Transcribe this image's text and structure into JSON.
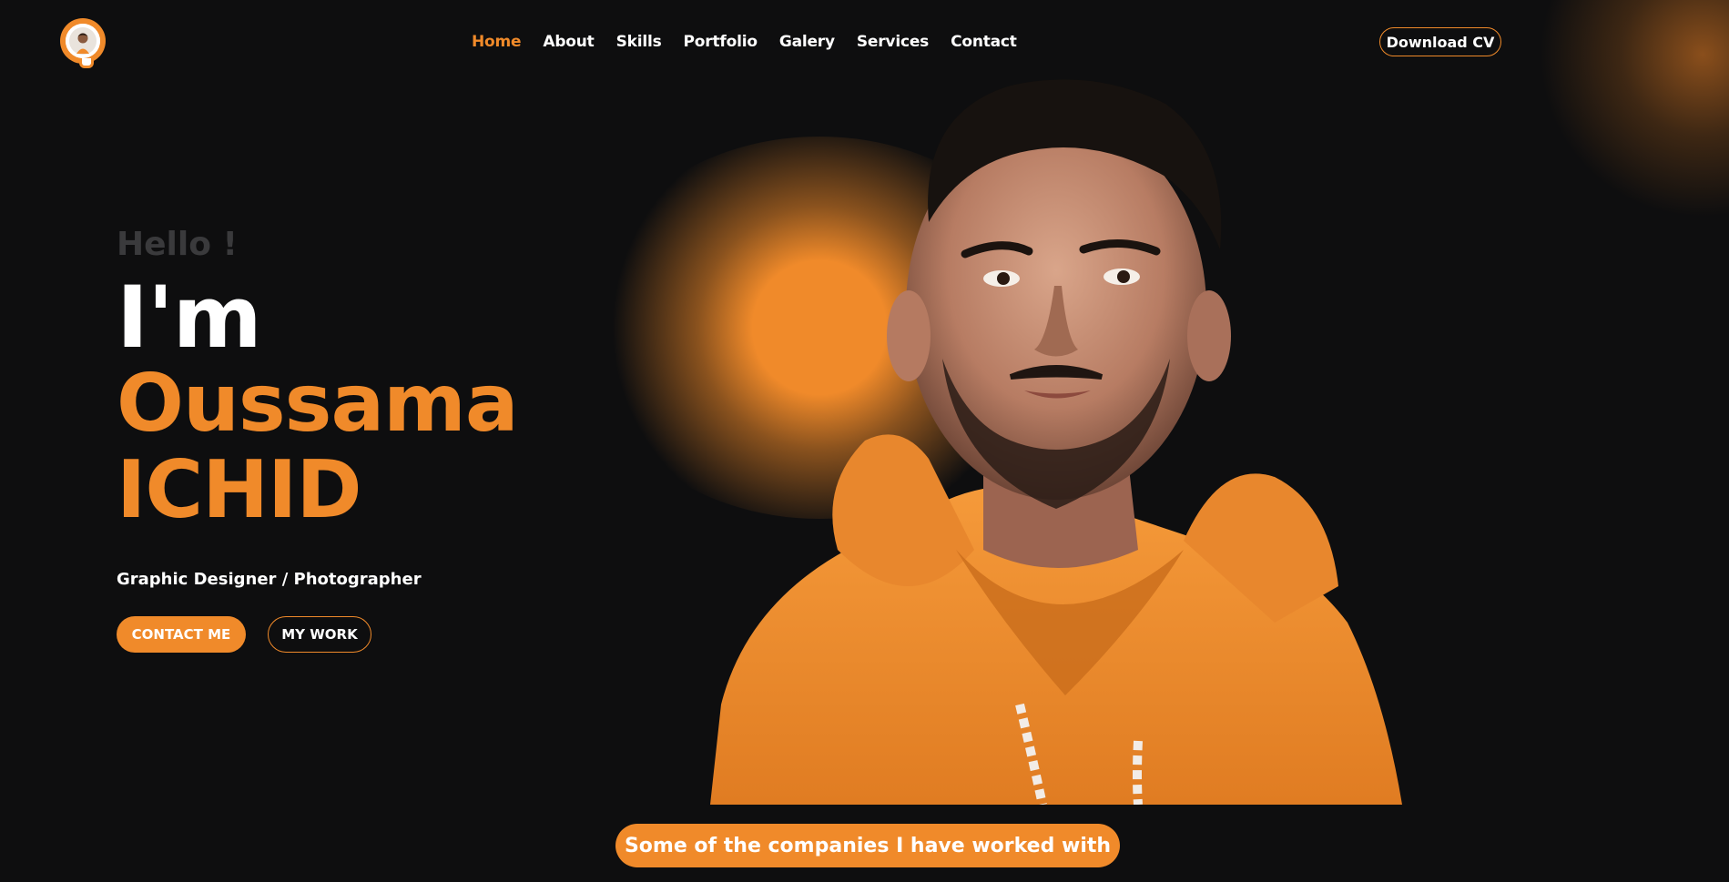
{
  "header": {
    "logo_icon": "avatar-logo-icon",
    "nav": [
      {
        "label": "Home",
        "active": true
      },
      {
        "label": "About"
      },
      {
        "label": "Skills"
      },
      {
        "label": "Portfolio"
      },
      {
        "label": "Galery"
      },
      {
        "label": "Services"
      },
      {
        "label": "Contact"
      }
    ],
    "cv_button": "Download CV"
  },
  "hero": {
    "greeting": "Hello !",
    "intro": "I'm",
    "first_name": "Oussama",
    "last_name": "ICHID",
    "role": "Graphic Designer / Photographer",
    "contact_button": "CONTACT ME",
    "work_button": "MY WORK"
  },
  "companies": {
    "label": "Some of the companies I have worked with"
  },
  "colors": {
    "accent": "#f08a2a",
    "background": "#0e0e0f",
    "muted": "#3a3a3c"
  }
}
